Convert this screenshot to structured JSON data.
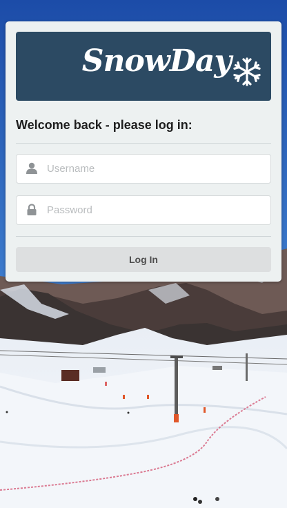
{
  "brand": {
    "name": "SnowDay",
    "logo_icon": "snowflake-icon",
    "logo_bg": "#2c4a63"
  },
  "login": {
    "heading": "Welcome back - please log in:",
    "username": {
      "placeholder": "Username",
      "value": "",
      "icon": "user-icon"
    },
    "password": {
      "placeholder": "Password",
      "value": "",
      "icon": "lock-icon"
    },
    "submit_label": "Log In"
  },
  "background": {
    "description_icon": "ski-slope-photo"
  }
}
